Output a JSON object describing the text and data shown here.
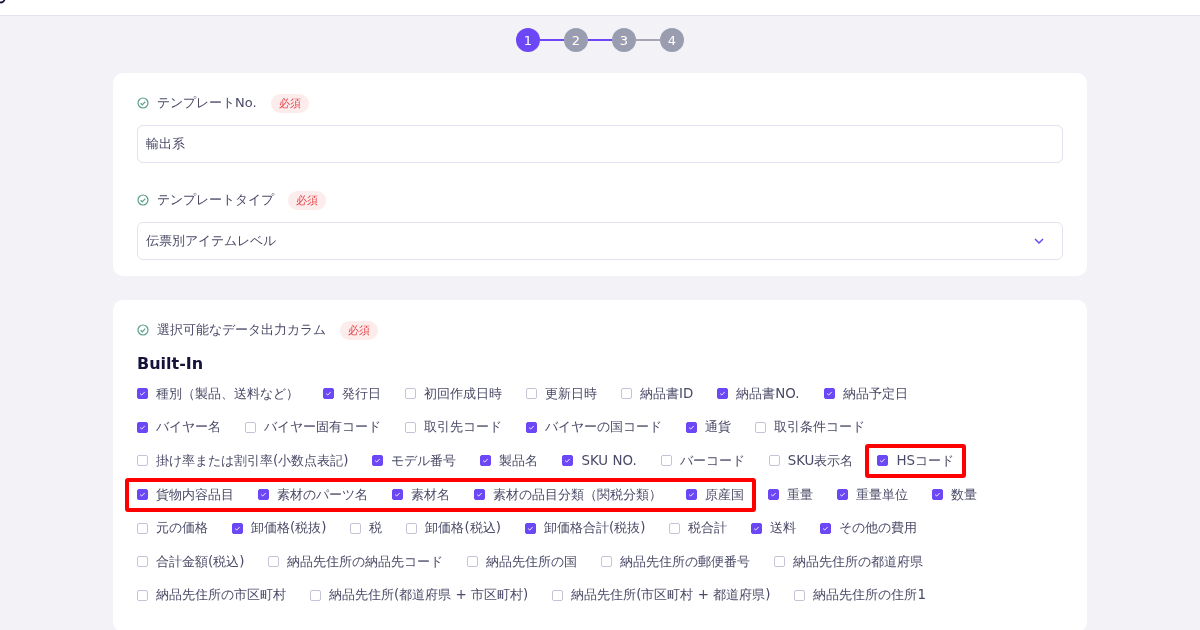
{
  "stepper": {
    "steps": [
      {
        "label": "1",
        "selected": true
      },
      {
        "label": "2",
        "selected": false
      },
      {
        "label": "3",
        "selected": false
      },
      {
        "label": "4",
        "selected": false
      }
    ],
    "connectors": [
      {
        "active": true
      },
      {
        "active": true
      },
      {
        "active": false
      }
    ]
  },
  "template_card": {
    "fields": [
      {
        "kind": "text",
        "label": "テンプレートNo.",
        "badge": "必須",
        "value": "輸出系"
      },
      {
        "kind": "select",
        "label": "テンプレートタイプ",
        "badge": "必須",
        "value": "伝票別アイテムレベル"
      }
    ]
  },
  "columns_card": {
    "label": "選択可能なデータ出力カラム",
    "badge": "必須",
    "section_title": "Built-In",
    "lines": [
      {
        "options": [
          {
            "label": "種別（製品、送料など）",
            "checked": true,
            "highlighted": false
          },
          {
            "label": "発行日",
            "checked": true,
            "highlighted": false
          },
          {
            "label": "初回作成日時",
            "checked": false,
            "highlighted": false
          },
          {
            "label": "更新日時",
            "checked": false,
            "highlighted": false
          },
          {
            "label": "納品書ID",
            "checked": false,
            "highlighted": false
          },
          {
            "label": "納品書NO.",
            "checked": true,
            "highlighted": false
          },
          {
            "label": "納品予定日",
            "checked": true,
            "highlighted": false
          }
        ]
      },
      {
        "options": [
          {
            "label": "バイヤー名",
            "checked": true,
            "highlighted": false
          },
          {
            "label": "バイヤー固有コード",
            "checked": false,
            "highlighted": false
          },
          {
            "label": "取引先コード",
            "checked": false,
            "highlighted": false
          },
          {
            "label": "バイヤーの国コード",
            "checked": true,
            "highlighted": false
          },
          {
            "label": "通貨",
            "checked": true,
            "highlighted": false
          },
          {
            "label": "取引条件コード",
            "checked": false,
            "highlighted": false
          }
        ]
      },
      {
        "options": [
          {
            "label": "掛け率または割引率(小数点表記)",
            "checked": false,
            "highlighted": false
          },
          {
            "label": "モデル番号",
            "checked": true,
            "highlighted": false
          },
          {
            "label": "製品名",
            "checked": true,
            "highlighted": false
          },
          {
            "label": "SKU NO.",
            "checked": true,
            "highlighted": false
          },
          {
            "label": "バーコード",
            "checked": false,
            "highlighted": false
          },
          {
            "label": "SKU表示名",
            "checked": false,
            "highlighted": false
          },
          {
            "label": "HSコード",
            "checked": true,
            "highlighted": true
          }
        ]
      },
      {
        "options": [
          {
            "label": "貨物内容品目",
            "checked": true,
            "highlighted": true
          },
          {
            "label": "素材のパーツ名",
            "checked": true,
            "highlighted": true
          },
          {
            "label": "素材名",
            "checked": true,
            "highlighted": true
          },
          {
            "label": "素材の品目分類（関税分類）",
            "checked": true,
            "highlighted": true
          },
          {
            "label": "原産国",
            "checked": true,
            "highlighted": true
          },
          {
            "label": "重量",
            "checked": true,
            "highlighted": false
          },
          {
            "label": "重量単位",
            "checked": true,
            "highlighted": false
          },
          {
            "label": "数量",
            "checked": true,
            "highlighted": false
          }
        ]
      },
      {
        "options": [
          {
            "label": "元の価格",
            "checked": false,
            "highlighted": false
          },
          {
            "label": "卸価格(税抜)",
            "checked": true,
            "highlighted": false
          },
          {
            "label": "税",
            "checked": false,
            "highlighted": false
          },
          {
            "label": "卸価格(税込)",
            "checked": false,
            "highlighted": false
          },
          {
            "label": "卸価格合計(税抜)",
            "checked": true,
            "highlighted": false
          },
          {
            "label": "税合計",
            "checked": false,
            "highlighted": false
          },
          {
            "label": "送料",
            "checked": true,
            "highlighted": false
          },
          {
            "label": "その他の費用",
            "checked": true,
            "highlighted": false
          }
        ]
      },
      {
        "options": [
          {
            "label": "合計金額(税込)",
            "checked": false,
            "highlighted": false
          },
          {
            "label": "納品先住所の納品先コード",
            "checked": false,
            "highlighted": false
          },
          {
            "label": "納品先住所の国",
            "checked": false,
            "highlighted": false
          },
          {
            "label": "納品先住所の郵便番号",
            "checked": false,
            "highlighted": false
          },
          {
            "label": "納品先住所の都道府県",
            "checked": false,
            "highlighted": false
          }
        ]
      },
      {
        "options": [
          {
            "label": "納品先住所の市区町村",
            "checked": false,
            "highlighted": false
          },
          {
            "label": "納品先住所(都道府県 + 市区町村)",
            "checked": false,
            "highlighted": false
          },
          {
            "label": "納品先住所(市区町村 + 都道府県)",
            "checked": false,
            "highlighted": false
          },
          {
            "label": "納品先住所の住所1",
            "checked": false,
            "highlighted": false
          }
        ]
      }
    ]
  }
}
